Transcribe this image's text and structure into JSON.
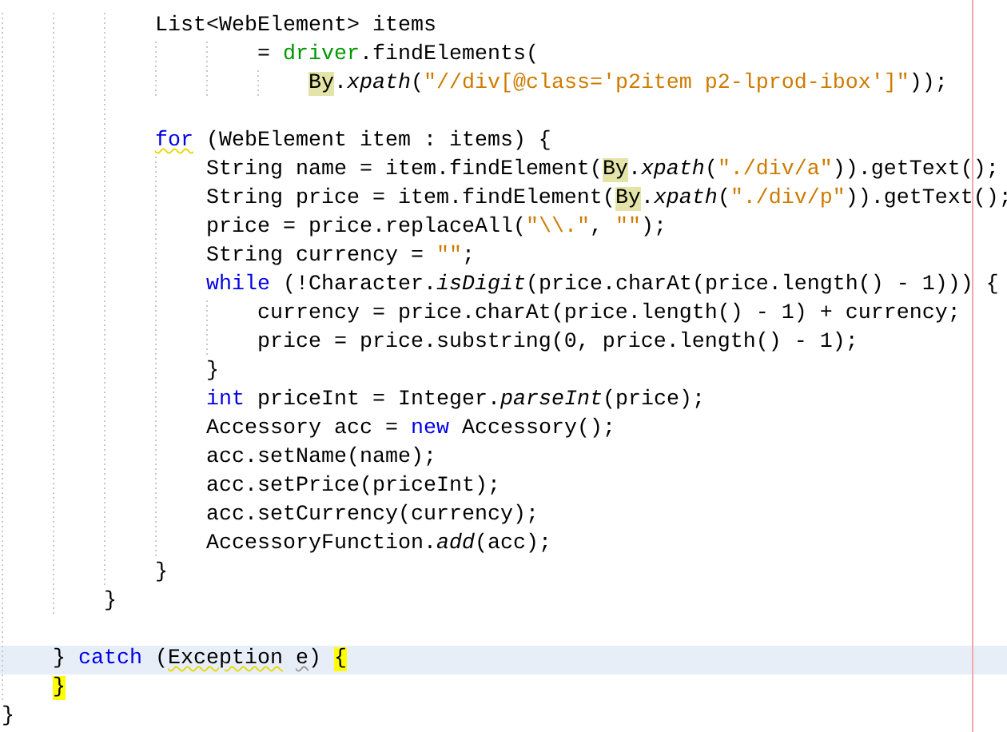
{
  "editor": {
    "lines": [
      {
        "kind": "group",
        "children": [
          {
            "kind": "group",
            "children": [
              {
                "kind": "group",
                "children": [
                  {
                    "kind": "code",
                    "current": false,
                    "tokens": [
                      {
                        "text": "List<WebElement> items",
                        "kind": "plain"
                      }
                    ],
                    "children": [
                      {
                        "kind": "continuation",
                        "current": false,
                        "tokens": [
                          {
                            "text": "= ",
                            "kind": "plain"
                          },
                          {
                            "text": "driver",
                            "kind": "field"
                          },
                          {
                            "text": ".findElements(",
                            "kind": "plain"
                          }
                        ],
                        "children": [
                          {
                            "kind": "continuation",
                            "current": false,
                            "tokens": [
                              {
                                "text": "By",
                                "kind": "plain",
                                "occurrence": true
                              },
                              {
                                "text": ".",
                                "kind": "plain"
                              },
                              {
                                "text": "xpath",
                                "kind": "static"
                              },
                              {
                                "text": "(",
                                "kind": "plain"
                              },
                              {
                                "text": "\"//div[@class='p2item p2-lprod-ibox']\"",
                                "kind": "string"
                              },
                              {
                                "text": "));",
                                "kind": "plain"
                              }
                            ]
                          }
                        ]
                      }
                    ]
                  },
                  {
                    "kind": "blank"
                  },
                  {
                    "kind": "code",
                    "current": false,
                    "tokens": [
                      {
                        "text": "for",
                        "kind": "keyword",
                        "warning": true
                      },
                      {
                        "text": " (WebElement item : items) {",
                        "kind": "plain"
                      }
                    ],
                    "children": [
                      {
                        "kind": "code",
                        "current": false,
                        "tokens": [
                          {
                            "text": "String name = item.findElement(",
                            "kind": "plain"
                          },
                          {
                            "text": "By",
                            "kind": "plain",
                            "occurrence": true
                          },
                          {
                            "text": ".",
                            "kind": "plain"
                          },
                          {
                            "text": "xpath",
                            "kind": "static"
                          },
                          {
                            "text": "(",
                            "kind": "plain"
                          },
                          {
                            "text": "\"./div/a\"",
                            "kind": "string"
                          },
                          {
                            "text": ")).getText();",
                            "kind": "plain"
                          }
                        ]
                      },
                      {
                        "kind": "code",
                        "current": false,
                        "tokens": [
                          {
                            "text": "String price = item.findElement(",
                            "kind": "plain"
                          },
                          {
                            "text": "By",
                            "kind": "plain",
                            "occurrence": true
                          },
                          {
                            "text": ".",
                            "kind": "plain"
                          },
                          {
                            "text": "xpath",
                            "kind": "static"
                          },
                          {
                            "text": "(",
                            "kind": "plain"
                          },
                          {
                            "text": "\"./div/p\"",
                            "kind": "string"
                          },
                          {
                            "text": ")).getText();",
                            "kind": "plain"
                          }
                        ]
                      },
                      {
                        "kind": "code",
                        "current": false,
                        "tokens": [
                          {
                            "text": "price = price.replaceAll(",
                            "kind": "plain"
                          },
                          {
                            "text": "\"\\\\.\"",
                            "kind": "string"
                          },
                          {
                            "text": ", ",
                            "kind": "plain"
                          },
                          {
                            "text": "\"\"",
                            "kind": "string"
                          },
                          {
                            "text": ");",
                            "kind": "plain"
                          }
                        ]
                      },
                      {
                        "kind": "code",
                        "current": false,
                        "tokens": [
                          {
                            "text": "String currency = ",
                            "kind": "plain"
                          },
                          {
                            "text": "\"\"",
                            "kind": "string"
                          },
                          {
                            "text": ";",
                            "kind": "plain"
                          }
                        ]
                      },
                      {
                        "kind": "code",
                        "current": false,
                        "tokens": [
                          {
                            "text": "while",
                            "kind": "keyword"
                          },
                          {
                            "text": " (!Character.",
                            "kind": "plain"
                          },
                          {
                            "text": "isDigit",
                            "kind": "static"
                          },
                          {
                            "text": "(price.charAt(price.length() - 1))) {",
                            "kind": "plain"
                          }
                        ],
                        "children": [
                          {
                            "kind": "code",
                            "current": false,
                            "tokens": [
                              {
                                "text": "currency = price.charAt(price.length() - 1) + currency;",
                                "kind": "plain"
                              }
                            ]
                          },
                          {
                            "kind": "code",
                            "current": false,
                            "tokens": [
                              {
                                "text": "price = price.substring(0, price.length() - 1);",
                                "kind": "plain"
                              }
                            ]
                          }
                        ]
                      },
                      {
                        "kind": "code",
                        "current": false,
                        "tokens": [
                          {
                            "text": "}",
                            "kind": "plain"
                          }
                        ]
                      },
                      {
                        "kind": "code",
                        "current": false,
                        "tokens": [
                          {
                            "text": "int",
                            "kind": "keyword"
                          },
                          {
                            "text": " priceInt = Integer.",
                            "kind": "plain"
                          },
                          {
                            "text": "parseInt",
                            "kind": "static"
                          },
                          {
                            "text": "(price);",
                            "kind": "plain"
                          }
                        ]
                      },
                      {
                        "kind": "code",
                        "current": false,
                        "tokens": [
                          {
                            "text": "Accessory acc = ",
                            "kind": "plain"
                          },
                          {
                            "text": "new",
                            "kind": "keyword"
                          },
                          {
                            "text": " Accessory();",
                            "kind": "plain"
                          }
                        ]
                      },
                      {
                        "kind": "code",
                        "current": false,
                        "tokens": [
                          {
                            "text": "acc.setName(name);",
                            "kind": "plain"
                          }
                        ]
                      },
                      {
                        "kind": "code",
                        "current": false,
                        "tokens": [
                          {
                            "text": "acc.setPrice(priceInt);",
                            "kind": "plain"
                          }
                        ]
                      },
                      {
                        "kind": "code",
                        "current": false,
                        "tokens": [
                          {
                            "text": "acc.setCurrency(currency);",
                            "kind": "plain"
                          }
                        ]
                      },
                      {
                        "kind": "code",
                        "current": false,
                        "tokens": [
                          {
                            "text": "AccessoryFunction.",
                            "kind": "plain"
                          },
                          {
                            "text": "add",
                            "kind": "static"
                          },
                          {
                            "text": "(acc);",
                            "kind": "plain"
                          }
                        ]
                      }
                    ]
                  },
                  {
                    "kind": "code",
                    "current": false,
                    "tokens": [
                      {
                        "text": "}",
                        "kind": "plain"
                      }
                    ]
                  }
                ]
              },
              {
                "kind": "code",
                "current": false,
                "tokens": [
                  {
                    "text": "}",
                    "kind": "plain"
                  }
                ]
              }
            ]
          },
          {
            "kind": "blank"
          },
          {
            "kind": "code",
            "current": true,
            "tokens": [
              {
                "text": "} ",
                "kind": "plain"
              },
              {
                "text": "catch",
                "kind": "keyword"
              },
              {
                "text": " (",
                "kind": "plain"
              },
              {
                "text": "Exception",
                "kind": "plain",
                "warning": true
              },
              {
                "text": " e",
                "kind": "plain",
                "hint": true
              },
              {
                "text": ") ",
                "kind": "plain"
              },
              {
                "text": "{",
                "kind": "plain",
                "matched": true
              }
            ]
          },
          {
            "kind": "code",
            "current": false,
            "tokens": [
              {
                "text": "}",
                "kind": "plain",
                "matched": true
              }
            ]
          }
        ]
      },
      {
        "kind": "code",
        "current": false,
        "tokens": [
          {
            "text": "}",
            "kind": "plain"
          }
        ]
      }
    ]
  }
}
